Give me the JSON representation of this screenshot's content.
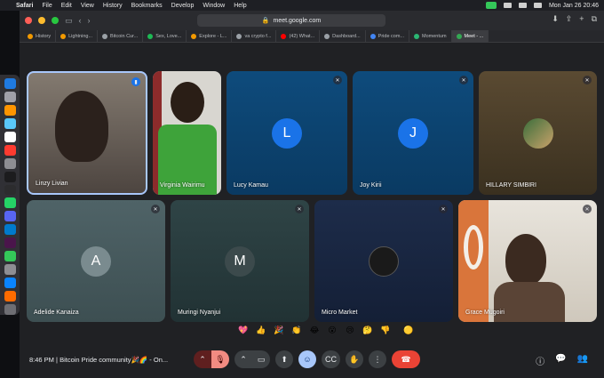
{
  "menubar": {
    "app_name": "Safari",
    "items": [
      "File",
      "Edit",
      "View",
      "History",
      "Bookmarks",
      "Develop",
      "Window",
      "Help"
    ],
    "datetime": "Mon Jan 26  20:46"
  },
  "browser": {
    "url": "meet.google.com",
    "tabs": [
      {
        "label": "History",
        "color": "#f29900"
      },
      {
        "label": "Lightning...",
        "color": "#f29900"
      },
      {
        "label": "Bitcoin Cur...",
        "color": "#9aa0a6"
      },
      {
        "label": "Sex, Love...",
        "color": "#1db954"
      },
      {
        "label": "Explore - L...",
        "color": "#f29900"
      },
      {
        "label": "va crypto f...",
        "color": "#9aa0a6"
      },
      {
        "label": "(42) What...",
        "color": "#ff0000"
      },
      {
        "label": "Dashboard...",
        "color": "#9aa0a6"
      },
      {
        "label": "Pride com...",
        "color": "#4285f4"
      },
      {
        "label": "Momentum",
        "color": "#2bb673"
      },
      {
        "label": "Meet - ...",
        "color": "#34a853"
      }
    ]
  },
  "participants": [
    {
      "name": "Linzy Livian",
      "type": "video",
      "colors": [
        "#6b6258",
        "#3a322b",
        "#8a7f72"
      ]
    },
    {
      "name": "Virginia Wairimu",
      "type": "video",
      "colors": [
        "#c9c7c0",
        "#3ea33a",
        "#2a1e16"
      ]
    },
    {
      "name": "Lucy Kamau",
      "type": "avatar",
      "initial": "L",
      "avatar_color": "#1a73e8"
    },
    {
      "name": "Joy Kirii",
      "type": "avatar",
      "initial": "J",
      "avatar_color": "#1a73e8"
    },
    {
      "name": "HILLARY SIMBIRI",
      "type": "photo"
    },
    {
      "name": "Adelide Kanaiza",
      "type": "avatar",
      "initial": "A",
      "avatar_color": "#7a8b8f"
    },
    {
      "name": "Muringi Nyanjui",
      "type": "avatar",
      "initial": "M",
      "avatar_color": "#3c4a4c"
    },
    {
      "name": "Micro Market",
      "type": "photo"
    },
    {
      "name": "Grace Mugoiri",
      "type": "video"
    }
  ],
  "meeting": {
    "time": "8:46 PM",
    "separator": "|",
    "title": "Bitcoin Pride community🎉🌈 - On..."
  },
  "reactions": [
    "💖",
    "👍",
    "🎉",
    "👏",
    "😂",
    "😮",
    "😢",
    "🤔",
    "👎"
  ],
  "icons": {
    "mic_off": "mic-off-icon",
    "camera": "camera-icon",
    "present": "present-icon",
    "emoji": "emoji-icon",
    "captions": "captions-icon",
    "hand": "raise-hand-icon",
    "more": "more-options-icon",
    "hangup": "hangup-icon",
    "info": "info-icon",
    "chat": "chat-icon",
    "people": "people-icon"
  }
}
